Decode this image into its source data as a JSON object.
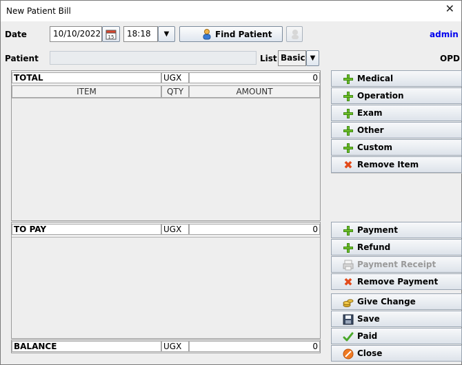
{
  "window": {
    "title": "New Patient Bill"
  },
  "header": {
    "date_label": "Date",
    "date_value": "10/10/2022",
    "time_value": "18:18",
    "find_patient_label": "Find Patient",
    "user": "admin",
    "patient_label": "Patient",
    "patient_value": "",
    "list_label": "List",
    "list_value": "Basic",
    "opd_label": "OPD"
  },
  "total": {
    "label": "TOTAL",
    "currency": "UGX",
    "amount": "0"
  },
  "items_table": {
    "columns": [
      "ITEM",
      "QTY",
      "AMOUNT"
    ],
    "rows": []
  },
  "to_pay": {
    "label": "TO PAY",
    "currency": "UGX",
    "amount": "0"
  },
  "balance": {
    "label": "BALANCE",
    "currency": "UGX",
    "amount": "0"
  },
  "actions": {
    "medical": "Medical",
    "operation": "Operation",
    "exam": "Exam",
    "other": "Other",
    "custom": "Custom",
    "remove_item": "Remove Item",
    "payment": "Payment",
    "refund": "Refund",
    "payment_receipt": "Payment Receipt",
    "remove_payment": "Remove Payment",
    "give_change": "Give Change",
    "save": "Save",
    "paid": "Paid",
    "close": "Close"
  },
  "colors": {
    "user": "#0000ee",
    "plus": "#6fbf2a",
    "remove": "#e24a1a"
  }
}
